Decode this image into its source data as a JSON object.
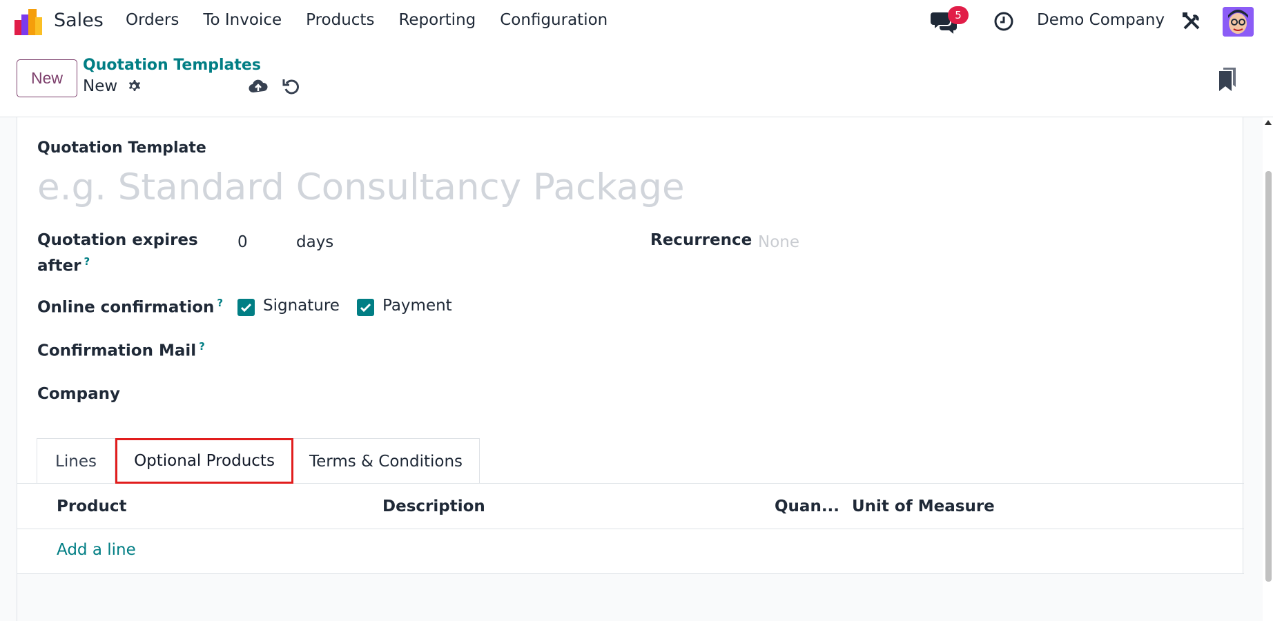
{
  "navbar": {
    "app_name": "Sales",
    "menu": [
      "Orders",
      "To Invoice",
      "Products",
      "Reporting",
      "Configuration"
    ],
    "message_count": "5",
    "company": "Demo Company",
    "icons": [
      "app-logo-icon",
      "chat-icon",
      "clock-icon",
      "tools-icon",
      "avatar"
    ]
  },
  "control_panel": {
    "new_label": "New",
    "breadcrumb": "Quotation Templates",
    "record_name": "New"
  },
  "form": {
    "title_label": "Quotation Template",
    "name_placeholder": "e.g. Standard Consultancy Package",
    "expires_label_1": "Quotation expires",
    "expires_label_2": "after",
    "expires_value": "0",
    "expires_unit": "days",
    "recurrence_label": "Recurrence",
    "recurrence_value": "None",
    "online_confirmation_label": "Online confirmation",
    "signature_label": "Signature",
    "signature_checked": true,
    "payment_label": "Payment",
    "payment_checked": true,
    "confirmation_mail_label": "Confirmation Mail",
    "company_label": "Company",
    "help_mark": "?"
  },
  "tabs": [
    "Lines",
    "Optional Products",
    "Terms & Conditions"
  ],
  "active_tab": "Optional Products",
  "list": {
    "columns": [
      "Product",
      "Description",
      "Quan...",
      "Unit of Measure"
    ],
    "add_line": "Add a line"
  },
  "colors": {
    "accent": "#017e84",
    "brand": "#7c3e6b",
    "badge": "#e11d48",
    "highlight": "#e11d1d"
  }
}
